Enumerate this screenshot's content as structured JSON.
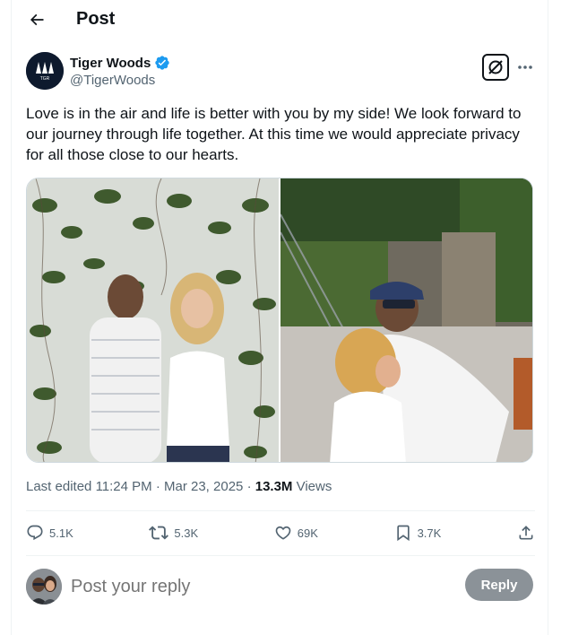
{
  "header": {
    "title": "Post",
    "back_icon": "arrow-left-icon"
  },
  "author": {
    "name": "Tiger Woods",
    "handle": "@TigerWoods",
    "verified": true,
    "verified_color": "#1d9bf0",
    "avatar_icon": "tgr-logo-avatar",
    "avatar_text": "TGR"
  },
  "post": {
    "text": "Love is in the air and life is better with you by my side! We look forward to our journey through life together. At this time we would appreciate privacy for all those close to our hearts.",
    "images": [
      {
        "name": "photo-couple-standing"
      },
      {
        "name": "photo-couple-hammock"
      }
    ],
    "meta": {
      "edited_label": "Last edited",
      "time": "11:24 PM",
      "separator": "·",
      "date": "Mar 23, 2025",
      "views_count": "13.3M",
      "views_label": "Views"
    }
  },
  "actions": {
    "replies": "5.1K",
    "reposts": "5.3K",
    "likes": "69K",
    "bookmarks": "3.7K"
  },
  "reply_box": {
    "placeholder": "Post your reply",
    "button_label": "Reply",
    "button_color": "#8b9298"
  }
}
